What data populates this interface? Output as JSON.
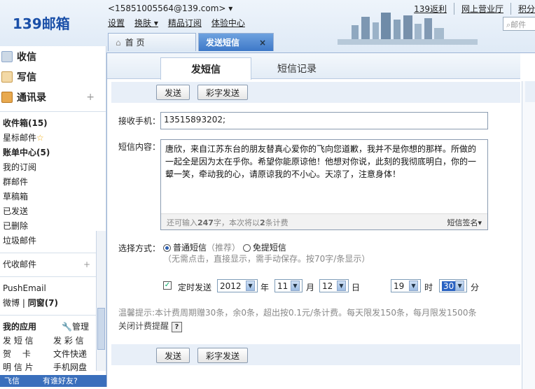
{
  "header": {
    "logo": "139邮箱",
    "user": "<15851005564@139.com> ▾",
    "menu": [
      "设置",
      "换肤 ▾",
      "精品订阅",
      "体验中心"
    ],
    "links": [
      "139返利",
      "网上营业厅",
      "积分"
    ],
    "search_placeholder": "邮件"
  },
  "tabs": {
    "home": "首 页",
    "sms": "发送短信",
    "close": "×"
  },
  "sidebar": {
    "receive": "收信",
    "write": "写信",
    "contacts": "通讯录",
    "plus": "+",
    "items": [
      "收件箱(15)",
      "星标邮件",
      "账单中心(5)",
      "我的订阅",
      "群邮件",
      "草稿箱",
      "已发送",
      "已删除",
      "垃圾邮件"
    ],
    "collect": "代收邮件",
    "pushemail": "PushEmail",
    "weibo": "微博",
    "circle": "同窗(7)",
    "myapps": "我的应用",
    "manage": "管理",
    "apps": [
      "发 短 信",
      "发 彩 信",
      "贺　 卡",
      "文件快递",
      "明 信 片",
      "手机网盘"
    ],
    "bottom": "飞信　　　有谁好友?"
  },
  "main": {
    "tab_send": "发短信",
    "tab_history": "短信记录",
    "send_btn": "发送",
    "mms_btn": "彩字发送",
    "recipient_label": "接收手机：",
    "recipient_value": "13515893202;",
    "content_label": "短信内容：",
    "content": "唐欣，来自江苏东台的朋友替真心爱你的飞向您道歉，我并不是你想的那样。所做的一起全是因为太在乎你。希望你能原谅他！他想对你说，此刻的我彻底明白，你的一颦一笑，牵动我的心，请原谅我的不小心。天凉了，注意身体！",
    "counter_prefix": "还可输入",
    "counter_num": "247",
    "counter_mid": "字，本次将以",
    "counter_count": "2",
    "counter_suffix": "条计费",
    "signature": "短信签名▾",
    "mode_label": "选择方式：",
    "mode_normal": "普通短信",
    "mode_normal_note": "（推荐）",
    "mode_free": "免提短信",
    "mode_free_note": "（无需点击，直接显示，需手动保存。按70字/条显示）",
    "timed_label": "定时发送",
    "year": "2012",
    "year_unit": "年",
    "month": "11",
    "month_unit": "月",
    "day": "12",
    "day_unit": "日",
    "hour": "19",
    "hour_unit": "时",
    "minute": "30",
    "minute_unit": "分",
    "tip": "温馨提示:本计费周期赠30条，余0条，超出按0.1元/条计费。每天限发150条，每月限发1500条",
    "tip_link": "关闭计费提醒",
    "help": "?"
  }
}
